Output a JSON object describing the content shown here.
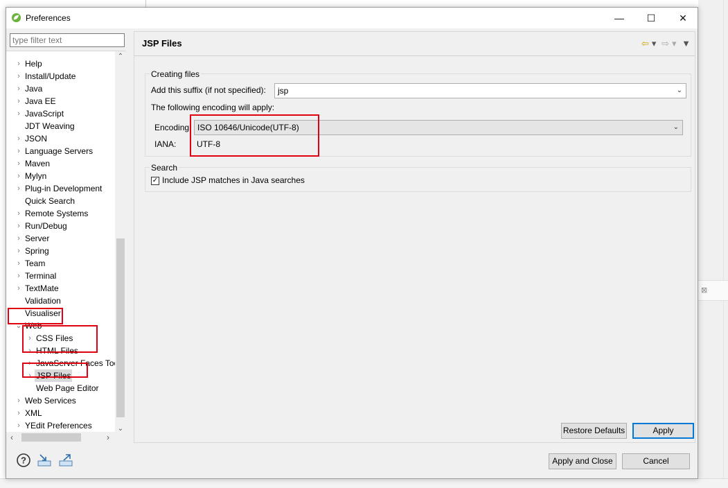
{
  "window": {
    "title": "Preferences",
    "minimize": "—",
    "maximize": "☐",
    "close": "✕"
  },
  "filter": {
    "placeholder": "type filter text"
  },
  "tree": [
    {
      "label": "Help",
      "expander": ">"
    },
    {
      "label": "Install/Update",
      "expander": ">"
    },
    {
      "label": "Java",
      "expander": ">"
    },
    {
      "label": "Java EE",
      "expander": ">"
    },
    {
      "label": "JavaScript",
      "expander": ">"
    },
    {
      "label": "JDT Weaving",
      "expander": ""
    },
    {
      "label": "JSON",
      "expander": ">"
    },
    {
      "label": "Language Servers",
      "expander": ">"
    },
    {
      "label": "Maven",
      "expander": ">"
    },
    {
      "label": "Mylyn",
      "expander": ">"
    },
    {
      "label": "Plug-in Development",
      "expander": ">"
    },
    {
      "label": "Quick Search",
      "expander": ""
    },
    {
      "label": "Remote Systems",
      "expander": ">"
    },
    {
      "label": "Run/Debug",
      "expander": ">"
    },
    {
      "label": "Server",
      "expander": ">"
    },
    {
      "label": "Spring",
      "expander": ">"
    },
    {
      "label": "Team",
      "expander": ">"
    },
    {
      "label": "Terminal",
      "expander": ">"
    },
    {
      "label": "TextMate",
      "expander": ">"
    },
    {
      "label": "Validation",
      "expander": ""
    },
    {
      "label": "Visualiser",
      "expander": ""
    },
    {
      "label": "Web",
      "expander": "v"
    },
    {
      "label": "CSS Files",
      "expander": ">"
    },
    {
      "label": "HTML Files",
      "expander": ">"
    },
    {
      "label": "JavaServer Faces Too",
      "expander": ">"
    },
    {
      "label": "JSP Files",
      "expander": ">"
    },
    {
      "label": "Web Page Editor",
      "expander": ""
    },
    {
      "label": "Web Services",
      "expander": ">"
    },
    {
      "label": "XML",
      "expander": ">"
    },
    {
      "label": "YEdit Preferences",
      "expander": ">"
    }
  ],
  "page": {
    "title": "JSP Files",
    "creating": {
      "group_title": "Creating files",
      "suffix_label": "Add this suffix (if not specified):",
      "suffix_value": "jsp",
      "encoding_note": "The following encoding will apply:",
      "encoding_label": "Encoding:",
      "encoding_value": "ISO 10646/Unicode(UTF-8)",
      "iana_label": "IANA:",
      "iana_value": "UTF-8"
    },
    "search": {
      "group_title": "Search",
      "checkbox_label": "Include JSP matches in Java searches",
      "checked": true
    }
  },
  "buttons": {
    "restore_defaults": "Restore Defaults",
    "apply": "Apply",
    "apply_and_close": "Apply and Close",
    "cancel": "Cancel"
  },
  "icons": {
    "help": "help-icon",
    "import": "import-icon",
    "export": "export-icon",
    "back": "back-arrow-icon",
    "forward": "forward-arrow-icon",
    "menu": "view-menu-icon"
  },
  "colors": {
    "highlight": "#e0000f",
    "selection": "#d9d9d9",
    "default_button_border": "#0078d7"
  }
}
